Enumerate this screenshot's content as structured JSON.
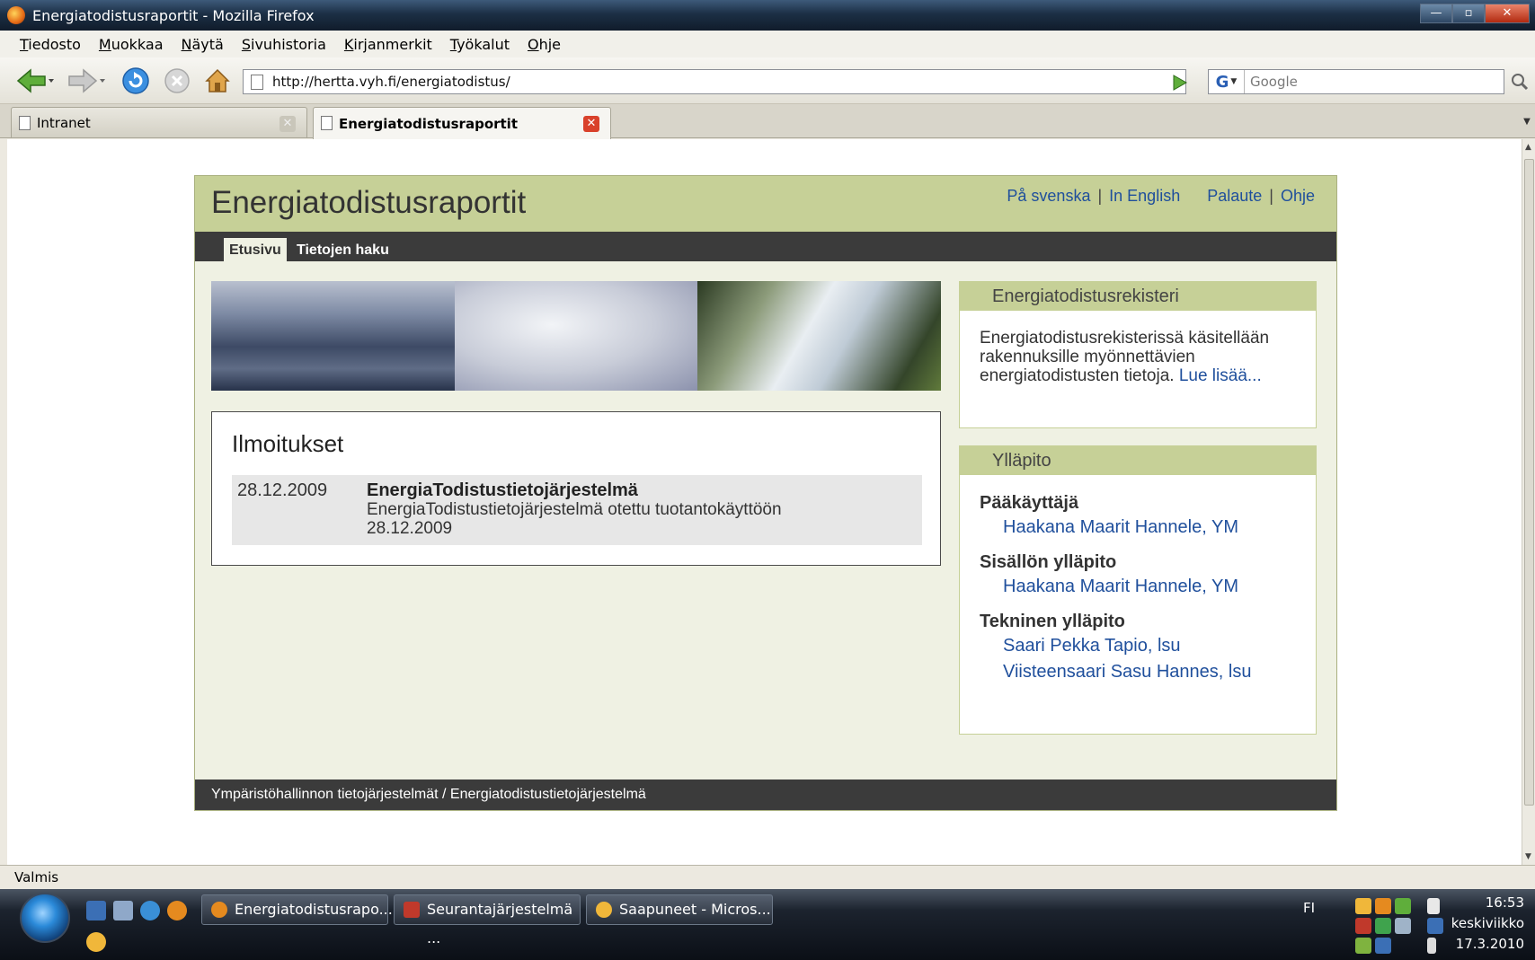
{
  "window": {
    "title": "Energiatodistusraportit - Mozilla Firefox"
  },
  "menu": [
    "Tiedosto",
    "Muokkaa",
    "Näytä",
    "Sivuhistoria",
    "Kirjanmerkit",
    "Työkalut",
    "Ohje"
  ],
  "navbar": {
    "url": "http://hertta.vyh.fi/energiatodistus/",
    "search_placeholder": "Google",
    "search_engine_letter": "G"
  },
  "tabs": [
    {
      "label": "Intranet",
      "active": false
    },
    {
      "label": "Energiatodistusraportit",
      "active": true
    }
  ],
  "site": {
    "title": "Energiatodistusraportit",
    "links": {
      "swedish": "På svenska",
      "english": "In English",
      "feedback": "Palaute",
      "help": "Ohje"
    },
    "nav": {
      "home": "Etusivu",
      "search": "Tietojen haku"
    },
    "notices": {
      "heading": "Ilmoitukset",
      "items": [
        {
          "date": "28.12.2009",
          "title": "EnergiaTodistustietojärjestelmä",
          "text": "EnergiaTodistustietojärjestelmä otettu tuotantokäyttöön 28.12.2009"
        }
      ]
    },
    "registry": {
      "heading": "Energiatodistusrekisteri",
      "text": "Energiatodistusrekisterissä käsitellään rakennuksille myönnettävien energiatodistusten tietoja.",
      "more_link": "Lue lisää..."
    },
    "maintenance": {
      "heading": "Ylläpito",
      "groups": [
        {
          "role": "Pääkäyttäjä",
          "people": [
            "Haakana Maarit Hannele, YM"
          ]
        },
        {
          "role": "Sisällön ylläpito",
          "people": [
            "Haakana Maarit Hannele, YM"
          ]
        },
        {
          "role": "Tekninen ylläpito",
          "people": [
            "Saari Pekka Tapio, lsu",
            "Viisteensaari Sasu Hannes, lsu"
          ]
        }
      ]
    },
    "footer": "Ympäristöhallinnon tietojärjestelmät / Energiatodistustietojärjestelmä"
  },
  "status": "Valmis",
  "taskbar": {
    "buttons": [
      "Energiatodistusrapo...",
      "Seurantajärjestelmä ...",
      "Saapuneet - Micros..."
    ],
    "language": "FI",
    "time": "16:53",
    "weekday": "keskiviikko",
    "date": "17.3.2010"
  },
  "colors": {
    "header_bg": "#c6d097",
    "nav_bg": "#3b3b3b",
    "link": "#1f4f9c",
    "close_tab": "#d9412b"
  }
}
